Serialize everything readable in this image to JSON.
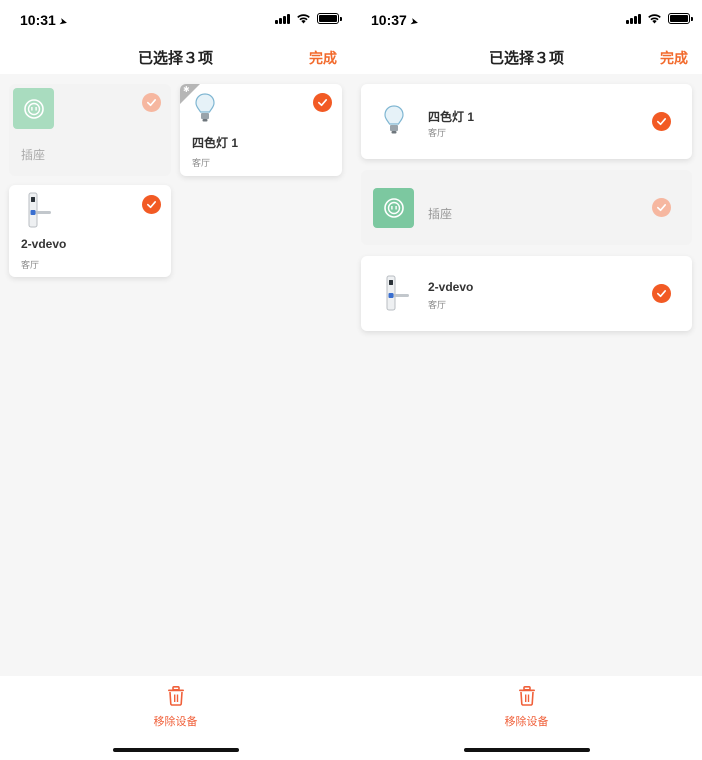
{
  "left": {
    "status": {
      "time": "10:31"
    },
    "nav": {
      "title": "已选择３项",
      "done": "完成"
    },
    "devices": [
      {
        "name": "插座",
        "room": "",
        "selected": true,
        "dimmed": true,
        "icon": "socket-icon"
      },
      {
        "name": "四色灯 1",
        "room": "客厅",
        "selected": true,
        "dimmed": false,
        "icon": "bulb-icon",
        "badge": "bluetooth-icon"
      },
      {
        "name": "2-vdevo",
        "room": "客厅",
        "selected": true,
        "dimmed": false,
        "icon": "door-lock-icon"
      }
    ],
    "bottom": {
      "remove_label": "移除设备"
    }
  },
  "right": {
    "status": {
      "time": "10:37"
    },
    "nav": {
      "title": "已选择３项",
      "done": "完成"
    },
    "devices": [
      {
        "name": "四色灯 1",
        "room": "客厅",
        "selected": true,
        "dimmed": false,
        "icon": "bulb-icon"
      },
      {
        "name": "插座",
        "room": "",
        "selected": true,
        "dimmed": true,
        "icon": "socket-icon"
      },
      {
        "name": "2-vdevo",
        "room": "客厅",
        "selected": true,
        "dimmed": false,
        "icon": "door-lock-icon"
      }
    ],
    "bottom": {
      "remove_label": "移除设备"
    }
  },
  "colors": {
    "accent": "#f25a24",
    "accent_dim": "#f6b7a0",
    "socket": "#7cc8a0",
    "remove": "#f0603a"
  }
}
